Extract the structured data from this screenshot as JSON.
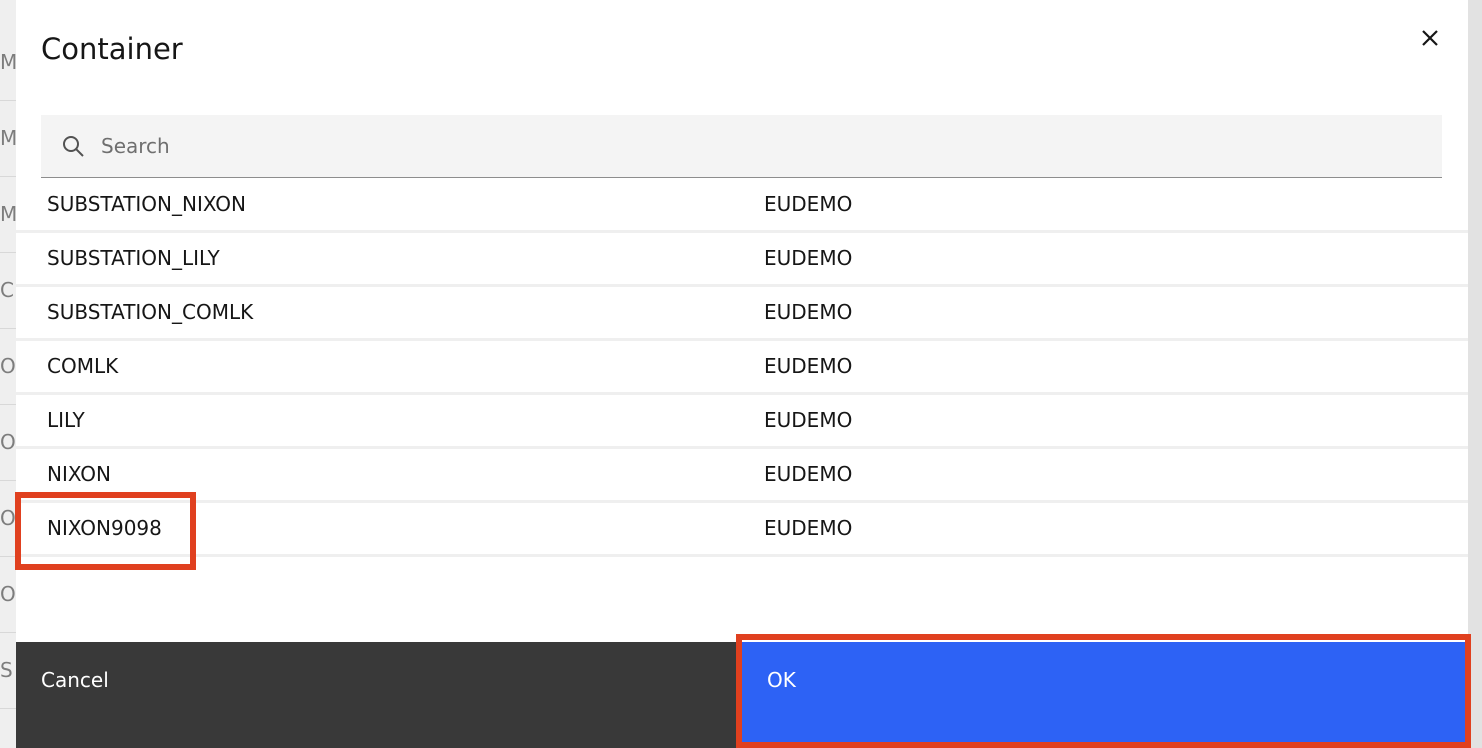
{
  "background": {
    "row_letters": [
      "M",
      "M",
      "M",
      "C",
      "O",
      "O",
      "O",
      "O",
      "S"
    ]
  },
  "modal": {
    "title": "Container",
    "close_icon": "close-icon",
    "search": {
      "placeholder": "Search",
      "value": "",
      "icon": "search-icon"
    },
    "rows": [
      {
        "name": "SUBSTATION_NIXON",
        "owner": "EUDEMO"
      },
      {
        "name": "SUBSTATION_LILY",
        "owner": "EUDEMO"
      },
      {
        "name": "SUBSTATION_COMLK",
        "owner": "EUDEMO"
      },
      {
        "name": "COMLK",
        "owner": "EUDEMO"
      },
      {
        "name": "LILY",
        "owner": "EUDEMO"
      },
      {
        "name": "NIXON",
        "owner": "EUDEMO"
      },
      {
        "name": "NIXON9098",
        "owner": "EUDEMO"
      }
    ],
    "footer": {
      "cancel_label": "Cancel",
      "ok_label": "OK"
    }
  },
  "colors": {
    "primary_button": "#2d62f5",
    "secondary_button": "#393939",
    "highlight": "#e0401f"
  }
}
